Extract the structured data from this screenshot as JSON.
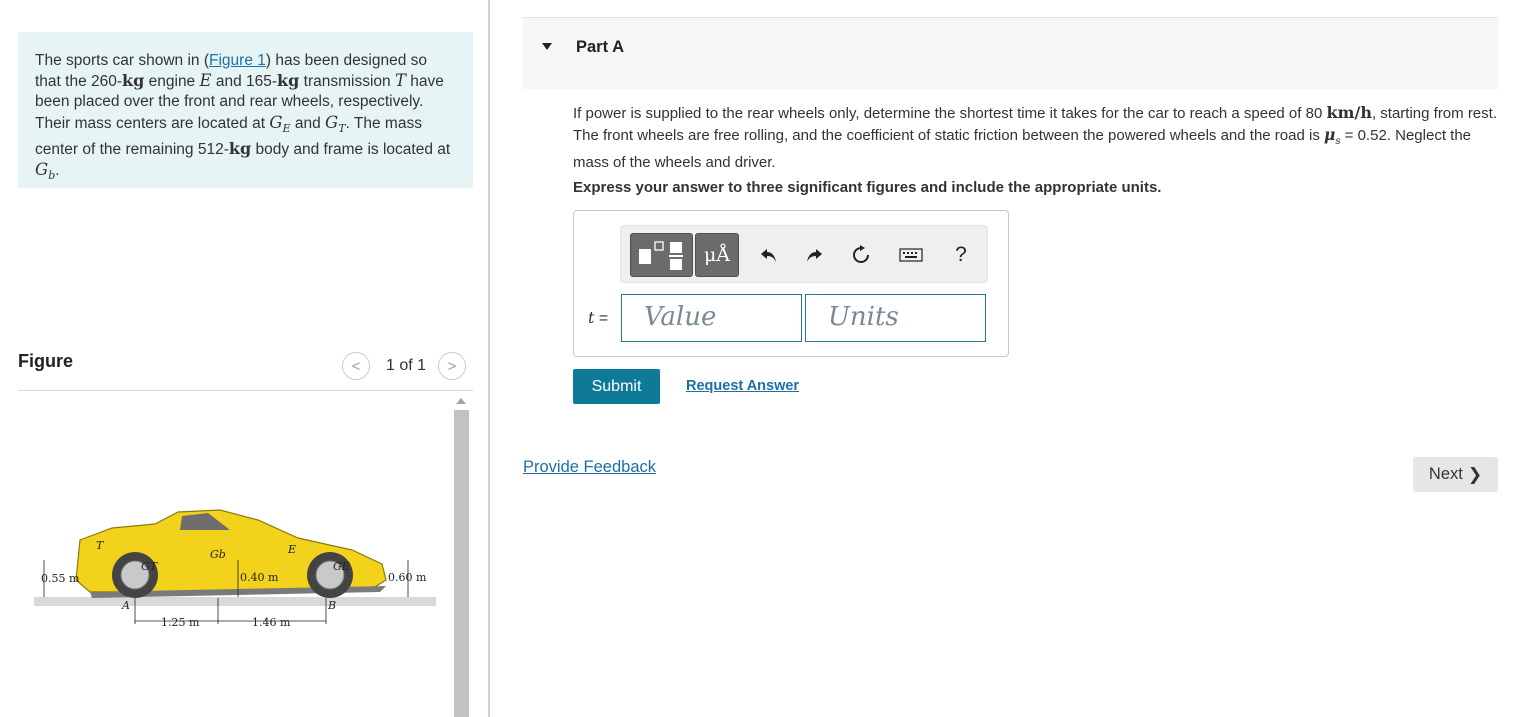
{
  "problem": {
    "p1": "The sports car shown in (",
    "figure_link": "Figure 1",
    "p2": ") has been designed so that the 260-",
    "kg1": "kg",
    "p3": " engine ",
    "E": "E",
    "p4": " and 165-",
    "kg2": "kg",
    "p5": " transmission ",
    "T": "T",
    "p6": " have been placed over the front and rear wheels, respectively. Their mass centers are located at ",
    "GE_base": "G",
    "GE_sub": "E",
    "p7": " and ",
    "GT_base": "G",
    "GT_sub": "T",
    "p8": ". The mass center of the remaining 512-",
    "kg3": "kg",
    "p9": " body and frame is located at ",
    "Gb_base": "G",
    "Gb_sub": "b",
    "p10": "."
  },
  "figure": {
    "title": "Figure",
    "counter": "1 of 1",
    "prev_glyph": "<",
    "next_glyph": ">",
    "labels": {
      "T": "T",
      "Gb": "Gb",
      "E": "E",
      "GT": "GT",
      "GE": "GE",
      "A": "A",
      "B": "B",
      "h_left": "0.55 m",
      "h_mid": "0.40 m",
      "h_right": "0.60 m",
      "d1": "1.25 m",
      "d2": "1.46 m"
    }
  },
  "part": {
    "label": "Part A"
  },
  "question": {
    "q1": "If power is supplied to the rear wheels only, determine the shortest time it takes for the car to reach a speed of 80 ",
    "unit": "km/h",
    "q2": ", starting from rest. The front wheels are free rolling, and the coefficient of static friction between the powered wheels and the road is ",
    "mu_base": "μ",
    "mu_sub": "s",
    "q3": " = 0.52. Neglect the mass of the wheels and driver.",
    "instruction": "Express your answer to three significant figures and include the appropriate units."
  },
  "answer": {
    "variable": "t",
    "equals": "=",
    "value_placeholder": "Value",
    "units_placeholder": "Units",
    "toolbar": {
      "units_btn": "μÅ",
      "undo_icon": "undo-icon",
      "redo_icon": "redo-icon",
      "reset_icon": "reset-icon",
      "keyboard_icon": "keyboard-icon",
      "help": "?"
    }
  },
  "actions": {
    "submit": "Submit",
    "request_answer": "Request Answer",
    "provide_feedback": "Provide Feedback",
    "next": "Next",
    "next_glyph": "❯"
  },
  "colors": {
    "accent": "#0f7a98",
    "link": "#1e6fa5",
    "problem_bg": "#e7f4f5",
    "car_yellow": "#f2d21b"
  }
}
